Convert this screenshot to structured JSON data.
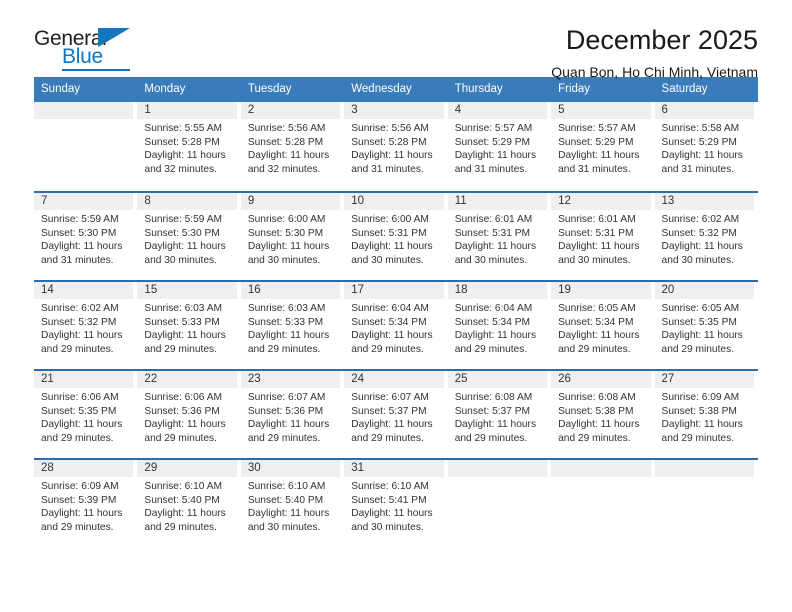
{
  "logo": {
    "general_text": "General",
    "blue_text": "Blue",
    "triangle_color": "#1277bc"
  },
  "header": {
    "title": "December 2025",
    "subtitle": "Quan Bon, Ho Chi Minh, Vietnam"
  },
  "theme": {
    "header_blue": "#3a7cb9",
    "row_divider_blue": "#2a6cb0",
    "day_strip_gray": "#efefef",
    "text_color": "#333333"
  },
  "weekdays": [
    "Sunday",
    "Monday",
    "Tuesday",
    "Wednesday",
    "Thursday",
    "Friday",
    "Saturday"
  ],
  "weeks": [
    [
      {
        "day": "",
        "empty": true,
        "lines": []
      },
      {
        "day": "1",
        "empty": false,
        "lines": [
          "Sunrise: 5:55 AM",
          "Sunset: 5:28 PM",
          "Daylight: 11 hours",
          "and 32 minutes."
        ]
      },
      {
        "day": "2",
        "empty": false,
        "lines": [
          "Sunrise: 5:56 AM",
          "Sunset: 5:28 PM",
          "Daylight: 11 hours",
          "and 32 minutes."
        ]
      },
      {
        "day": "3",
        "empty": false,
        "lines": [
          "Sunrise: 5:56 AM",
          "Sunset: 5:28 PM",
          "Daylight: 11 hours",
          "and 31 minutes."
        ]
      },
      {
        "day": "4",
        "empty": false,
        "lines": [
          "Sunrise: 5:57 AM",
          "Sunset: 5:29 PM",
          "Daylight: 11 hours",
          "and 31 minutes."
        ]
      },
      {
        "day": "5",
        "empty": false,
        "lines": [
          "Sunrise: 5:57 AM",
          "Sunset: 5:29 PM",
          "Daylight: 11 hours",
          "and 31 minutes."
        ]
      },
      {
        "day": "6",
        "empty": false,
        "lines": [
          "Sunrise: 5:58 AM",
          "Sunset: 5:29 PM",
          "Daylight: 11 hours",
          "and 31 minutes."
        ]
      }
    ],
    [
      {
        "day": "7",
        "empty": false,
        "lines": [
          "Sunrise: 5:59 AM",
          "Sunset: 5:30 PM",
          "Daylight: 11 hours",
          "and 31 minutes."
        ]
      },
      {
        "day": "8",
        "empty": false,
        "lines": [
          "Sunrise: 5:59 AM",
          "Sunset: 5:30 PM",
          "Daylight: 11 hours",
          "and 30 minutes."
        ]
      },
      {
        "day": "9",
        "empty": false,
        "lines": [
          "Sunrise: 6:00 AM",
          "Sunset: 5:30 PM",
          "Daylight: 11 hours",
          "and 30 minutes."
        ]
      },
      {
        "day": "10",
        "empty": false,
        "lines": [
          "Sunrise: 6:00 AM",
          "Sunset: 5:31 PM",
          "Daylight: 11 hours",
          "and 30 minutes."
        ]
      },
      {
        "day": "11",
        "empty": false,
        "lines": [
          "Sunrise: 6:01 AM",
          "Sunset: 5:31 PM",
          "Daylight: 11 hours",
          "and 30 minutes."
        ]
      },
      {
        "day": "12",
        "empty": false,
        "lines": [
          "Sunrise: 6:01 AM",
          "Sunset: 5:31 PM",
          "Daylight: 11 hours",
          "and 30 minutes."
        ]
      },
      {
        "day": "13",
        "empty": false,
        "lines": [
          "Sunrise: 6:02 AM",
          "Sunset: 5:32 PM",
          "Daylight: 11 hours",
          "and 30 minutes."
        ]
      }
    ],
    [
      {
        "day": "14",
        "empty": false,
        "lines": [
          "Sunrise: 6:02 AM",
          "Sunset: 5:32 PM",
          "Daylight: 11 hours",
          "and 29 minutes."
        ]
      },
      {
        "day": "15",
        "empty": false,
        "lines": [
          "Sunrise: 6:03 AM",
          "Sunset: 5:33 PM",
          "Daylight: 11 hours",
          "and 29 minutes."
        ]
      },
      {
        "day": "16",
        "empty": false,
        "lines": [
          "Sunrise: 6:03 AM",
          "Sunset: 5:33 PM",
          "Daylight: 11 hours",
          "and 29 minutes."
        ]
      },
      {
        "day": "17",
        "empty": false,
        "lines": [
          "Sunrise: 6:04 AM",
          "Sunset: 5:34 PM",
          "Daylight: 11 hours",
          "and 29 minutes."
        ]
      },
      {
        "day": "18",
        "empty": false,
        "lines": [
          "Sunrise: 6:04 AM",
          "Sunset: 5:34 PM",
          "Daylight: 11 hours",
          "and 29 minutes."
        ]
      },
      {
        "day": "19",
        "empty": false,
        "lines": [
          "Sunrise: 6:05 AM",
          "Sunset: 5:34 PM",
          "Daylight: 11 hours",
          "and 29 minutes."
        ]
      },
      {
        "day": "20",
        "empty": false,
        "lines": [
          "Sunrise: 6:05 AM",
          "Sunset: 5:35 PM",
          "Daylight: 11 hours",
          "and 29 minutes."
        ]
      }
    ],
    [
      {
        "day": "21",
        "empty": false,
        "lines": [
          "Sunrise: 6:06 AM",
          "Sunset: 5:35 PM",
          "Daylight: 11 hours",
          "and 29 minutes."
        ]
      },
      {
        "day": "22",
        "empty": false,
        "lines": [
          "Sunrise: 6:06 AM",
          "Sunset: 5:36 PM",
          "Daylight: 11 hours",
          "and 29 minutes."
        ]
      },
      {
        "day": "23",
        "empty": false,
        "lines": [
          "Sunrise: 6:07 AM",
          "Sunset: 5:36 PM",
          "Daylight: 11 hours",
          "and 29 minutes."
        ]
      },
      {
        "day": "24",
        "empty": false,
        "lines": [
          "Sunrise: 6:07 AM",
          "Sunset: 5:37 PM",
          "Daylight: 11 hours",
          "and 29 minutes."
        ]
      },
      {
        "day": "25",
        "empty": false,
        "lines": [
          "Sunrise: 6:08 AM",
          "Sunset: 5:37 PM",
          "Daylight: 11 hours",
          "and 29 minutes."
        ]
      },
      {
        "day": "26",
        "empty": false,
        "lines": [
          "Sunrise: 6:08 AM",
          "Sunset: 5:38 PM",
          "Daylight: 11 hours",
          "and 29 minutes."
        ]
      },
      {
        "day": "27",
        "empty": false,
        "lines": [
          "Sunrise: 6:09 AM",
          "Sunset: 5:38 PM",
          "Daylight: 11 hours",
          "and 29 minutes."
        ]
      }
    ],
    [
      {
        "day": "28",
        "empty": false,
        "lines": [
          "Sunrise: 6:09 AM",
          "Sunset: 5:39 PM",
          "Daylight: 11 hours",
          "and 29 minutes."
        ]
      },
      {
        "day": "29",
        "empty": false,
        "lines": [
          "Sunrise: 6:10 AM",
          "Sunset: 5:40 PM",
          "Daylight: 11 hours",
          "and 29 minutes."
        ]
      },
      {
        "day": "30",
        "empty": false,
        "lines": [
          "Sunrise: 6:10 AM",
          "Sunset: 5:40 PM",
          "Daylight: 11 hours",
          "and 30 minutes."
        ]
      },
      {
        "day": "31",
        "empty": false,
        "lines": [
          "Sunrise: 6:10 AM",
          "Sunset: 5:41 PM",
          "Daylight: 11 hours",
          "and 30 minutes."
        ]
      },
      {
        "day": "",
        "empty": true,
        "lines": []
      },
      {
        "day": "",
        "empty": true,
        "lines": []
      },
      {
        "day": "",
        "empty": true,
        "lines": []
      }
    ]
  ]
}
